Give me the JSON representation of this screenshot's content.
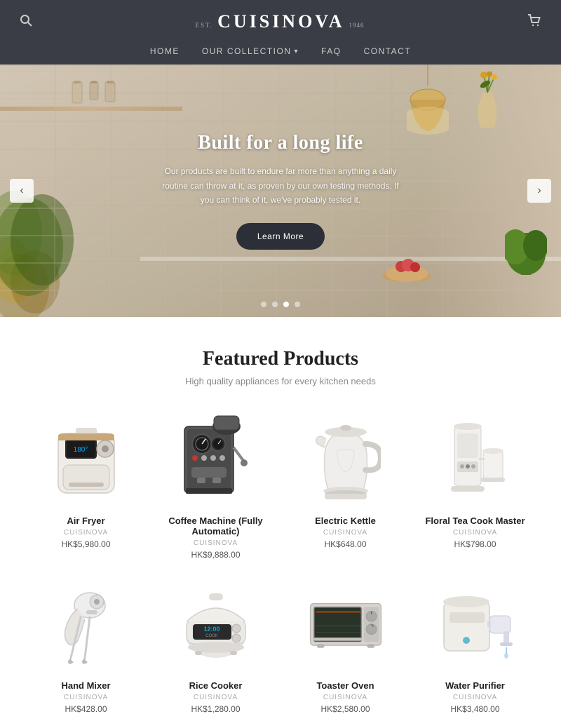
{
  "header": {
    "logo": {
      "est": "EST.",
      "name": "CUISINOVA",
      "year": "1946"
    },
    "nav": [
      {
        "label": "HOME",
        "hasDropdown": false
      },
      {
        "label": "OUR COLLECTION",
        "hasDropdown": true
      },
      {
        "label": "FAQ",
        "hasDropdown": false
      },
      {
        "label": "CONTACT",
        "hasDropdown": false
      }
    ]
  },
  "hero": {
    "title": "Built for a long life",
    "subtitle": "Our products are built to endure far more than anything a daily routine can throw at it, as proven by our own testing methods. If you can think of it, we've probably tested it.",
    "cta_label": "Learn More",
    "dots": [
      {
        "active": false
      },
      {
        "active": false
      },
      {
        "active": true
      },
      {
        "active": false
      }
    ]
  },
  "featured": {
    "title": "Featured Products",
    "subtitle": "High quality appliances for every kitchen needs",
    "products_row1": [
      {
        "name": "Air Fryer",
        "brand": "CUISINOVA",
        "price": "HK$5,980.00",
        "img_type": "air-fryer"
      },
      {
        "name": "Coffee Machine (Fully Automatic)",
        "brand": "CUISINOVA",
        "price": "HK$9,888.00",
        "img_type": "coffee-machine"
      },
      {
        "name": "Electric Kettle",
        "brand": "CUISINOVA",
        "price": "HK$648.00",
        "img_type": "kettle"
      },
      {
        "name": "Floral Tea Cook Master",
        "brand": "CUISINOVA",
        "price": "HK$798.00",
        "img_type": "tea-maker"
      }
    ],
    "products_row2": [
      {
        "name": "Hand Mixer",
        "brand": "CUISINOVA",
        "price": "HK$428.00",
        "img_type": "hand-mixer"
      },
      {
        "name": "Rice Cooker",
        "brand": "CUISINOVA",
        "price": "HK$1,280.00",
        "img_type": "rice-cooker"
      },
      {
        "name": "Toaster Oven",
        "brand": "CUISINOVA",
        "price": "HK$2,580.00",
        "img_type": "toaster-oven"
      },
      {
        "name": "Water Purifier",
        "brand": "CUISINOVA",
        "price": "HK$3,480.00",
        "img_type": "water-purifier"
      }
    ]
  }
}
